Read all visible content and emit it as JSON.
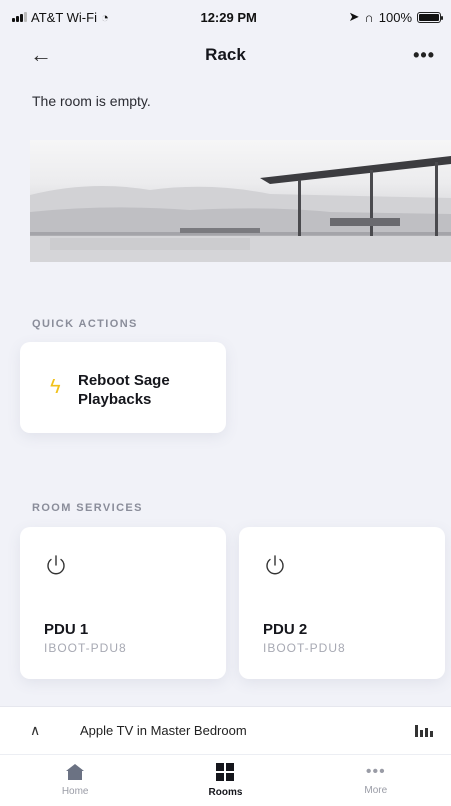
{
  "status_bar": {
    "carrier": "AT&T Wi-Fi",
    "time": "12:29 PM",
    "battery": "100%"
  },
  "nav": {
    "title": "Rack"
  },
  "room_status": "The room is empty.",
  "quick_actions": {
    "label": "QUICK ACTIONS",
    "items": [
      {
        "title": "Reboot Sage Playbacks",
        "icon": "lightning-icon",
        "icon_color": "#f1c21b"
      }
    ]
  },
  "room_services": {
    "label": "ROOM SERVICES",
    "items": [
      {
        "name": "PDU 1",
        "model": "IBOOT-PDU8",
        "icon": "power-icon"
      },
      {
        "name": "PDU 2",
        "model": "IBOOT-PDU8",
        "icon": "power-icon"
      }
    ]
  },
  "now_playing": {
    "text": "Apple TV in Master Bedroom"
  },
  "tabs": [
    {
      "label": "Home",
      "icon": "home-icon",
      "active": false
    },
    {
      "label": "Rooms",
      "icon": "rooms-icon",
      "active": true
    },
    {
      "label": "More",
      "icon": "more-icon",
      "active": false
    }
  ]
}
